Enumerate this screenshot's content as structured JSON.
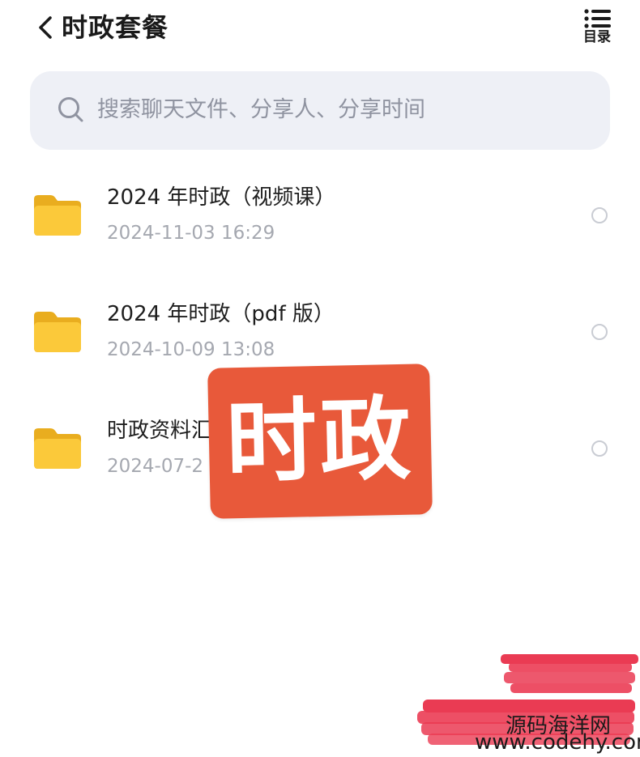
{
  "header": {
    "title": "时政套餐",
    "toc_label": "目录"
  },
  "search": {
    "placeholder": "搜索聊天文件、分享人、分享时间"
  },
  "files": [
    {
      "name": "2024 年时政（视频课）",
      "date": "2024-11-03 16:29"
    },
    {
      "name": "2024 年时政（pdf 版）",
      "date": "2024-10-09 13:08"
    },
    {
      "name": "时政资料汇",
      "date": "2024-07-2"
    }
  ],
  "overlay": {
    "stamp_text": "时政",
    "stamp_color": "#e8593a"
  },
  "watermark": {
    "line1": "源码海洋网",
    "line2": "www.codehy.com"
  },
  "colors": {
    "folder": "#fbc93a",
    "search_bg": "#eef0f6",
    "date_text": "#a5a8b0"
  }
}
